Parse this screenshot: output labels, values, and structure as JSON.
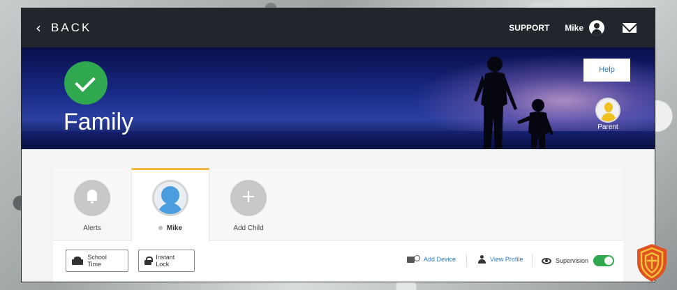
{
  "topbar": {
    "back_label": "BACK",
    "support_label": "SUPPORT",
    "username": "Mike"
  },
  "banner": {
    "title": "Family",
    "help_label": "Help",
    "parent_label": "Parent"
  },
  "tabs": [
    {
      "label": "Alerts",
      "icon": "bell-icon"
    },
    {
      "label": "Mike",
      "icon": "child-avatar-icon"
    },
    {
      "label": "Add Child",
      "icon": "plus-icon"
    }
  ],
  "actions": {
    "school_time_label": "School Time",
    "instant_lock_label": "Instant Lock",
    "add_device_label": "Add Device",
    "view_profile_label": "View Profile",
    "supervision_label": "Supervision",
    "supervision_on": true
  },
  "colors": {
    "topbar": "#20262c",
    "accent_green": "#2fa84f",
    "link_blue": "#2a7ac0",
    "active_tab": "#f5b63c"
  }
}
